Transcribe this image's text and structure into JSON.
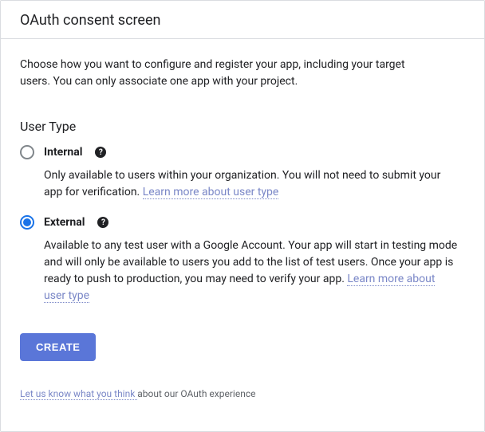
{
  "header": {
    "title": "OAuth consent screen"
  },
  "intro": "Choose how you want to configure and register your app, including your target users. You can only associate one app with your project.",
  "userType": {
    "sectionTitle": "User Type",
    "selected": "external",
    "internal": {
      "label": "Internal",
      "help": "?",
      "description": "Only available to users within your organization. You will not need to submit your app for verification. ",
      "learnMore": "Learn more about user type"
    },
    "external": {
      "label": "External",
      "help": "?",
      "description": "Available to any test user with a Google Account. Your app will start in testing mode and will only be available to users you add to the list of test users. Once your app is ready to push to production, you may need to verify your app. ",
      "learnMore": "Learn more about user type"
    }
  },
  "createButton": "CREATE",
  "feedback": {
    "linkText": "Let us know what you think ",
    "suffix": "about our OAuth experience"
  }
}
